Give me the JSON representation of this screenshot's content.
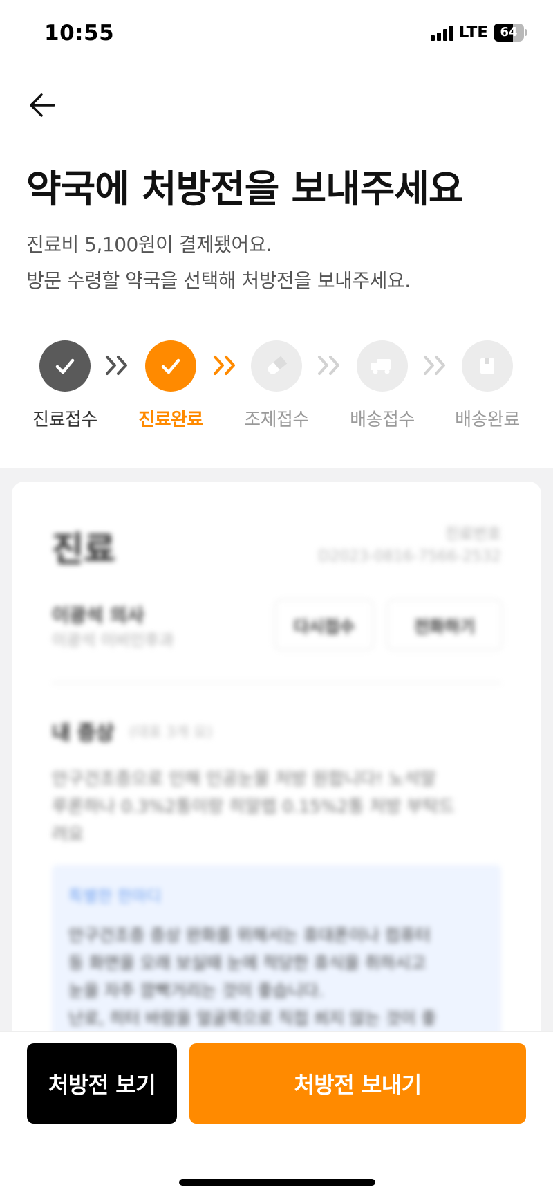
{
  "status_bar": {
    "time": "10:55",
    "network": "LTE",
    "battery": "64",
    "battery_level": 0.64
  },
  "header": {
    "title": "약국에 처방전을 보내주세요",
    "subtitle_line1": "진료비 5,100원이 결제됐어요.",
    "subtitle_line2": "방문 수령할 약국을 선택해 처방전을 보내주세요."
  },
  "steps": [
    {
      "label": "진료접수",
      "state": "done",
      "icon": "check-icon"
    },
    {
      "label": "진료완료",
      "state": "current",
      "icon": "check-icon"
    },
    {
      "label": "조제접수",
      "state": "pending",
      "icon": "pill-icon"
    },
    {
      "label": "배송접수",
      "state": "pending",
      "icon": "truck-icon"
    },
    {
      "label": "배송완료",
      "state": "pending",
      "icon": "box-icon"
    }
  ],
  "card": {
    "title": "진료",
    "number_label": "진료번호",
    "number_value": "D2023-0816-7566-2532",
    "doctor_name": "이광석 의사",
    "hospital": "이광석 이비인후과",
    "reaccept_button": "다시접수",
    "call_button": "전화하기",
    "symptom_title": "내 증상",
    "symptom_note": "(대표 3개 요)",
    "symptom_text_1": "안구건조증으로 인해 인공눈물 처방 원합니다! 노석말",
    "symptom_text_2": "루론하나 0.3%2통이랑 히알렙 0.15%2통 처방 부탁드",
    "symptom_text_3": "려요",
    "advice_title": "특별한 한마디",
    "advice_text_1": "안구건조증 증상 완화를 위해서는 휴대폰이나 컴퓨터",
    "advice_text_2": "등 화면을 오래 보실때 눈에 적당한 휴식을 취하시고",
    "advice_text_3": "눈을 자주 깜빡거리는 것이 좋습니다.",
    "advice_text_4": "난로, 히터 바람을 얼굴쪽으로 직접 쐬지 않는 것이 좋"
  },
  "buttons": {
    "view": "처방전 보기",
    "send": "처방전 보내기"
  },
  "colors": {
    "accent": "#ff8a00",
    "done": "#5a5a5a",
    "pending": "#ececec",
    "pending_text": "#9a9a9a"
  }
}
